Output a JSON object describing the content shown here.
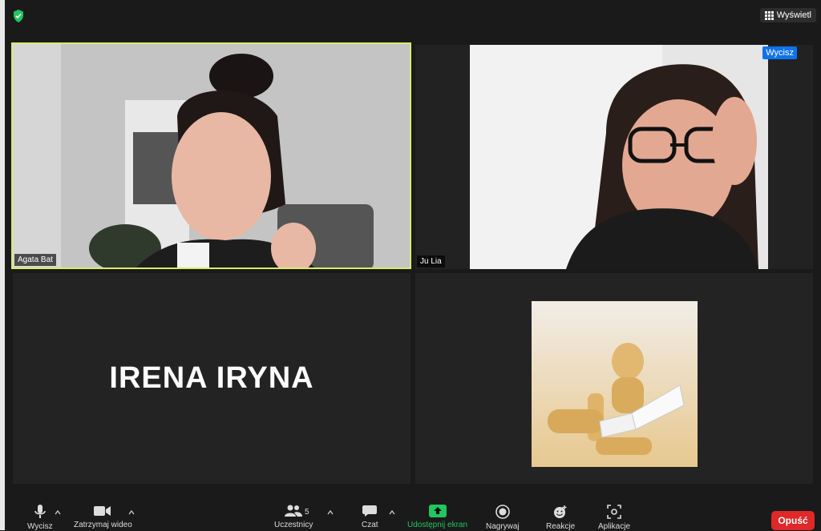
{
  "topbar": {
    "view_label": "Wyświetl"
  },
  "participants": {
    "agata": {
      "name": "Agata Bat"
    },
    "julia": {
      "name": "Ju Lia",
      "mute_badge": "Wycisz"
    },
    "irena": {
      "name": "IRENA IRYNA"
    }
  },
  "toolbar": {
    "mute": "Wycisz",
    "video": "Zatrzymaj wideo",
    "participants": "Uczestnicy",
    "participants_count": "5",
    "chat": "Czat",
    "share": "Udostępnij ekran",
    "record": "Nagrywaj",
    "reactions": "Reakcje",
    "apps": "Aplikacje",
    "leave": "Opuść"
  },
  "colors": {
    "active_speaker_border": "#d7ec6a",
    "share_green": "#22c55e",
    "leave_red": "#e02828",
    "badge_blue": "#0e72ed"
  }
}
